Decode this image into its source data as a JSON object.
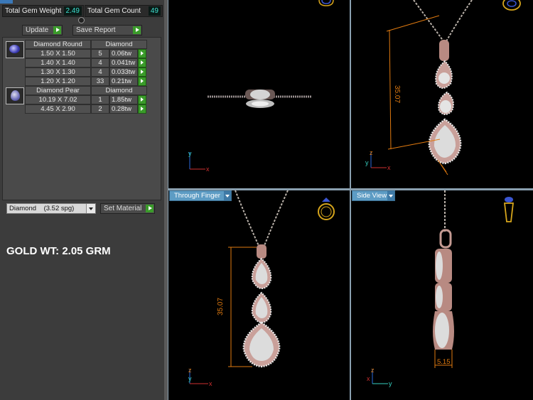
{
  "stats": {
    "total_gem_weight_label": "Total Gem Weight",
    "total_gem_weight_value": "2.49",
    "total_gem_count_label": "Total Gem Count",
    "total_gem_count_value": "49"
  },
  "toolbar": {
    "update_label": "Update",
    "save_report_label": "Save Report"
  },
  "round_table": {
    "header_size": "Diamond Round",
    "header_material": "Diamond",
    "rows": [
      {
        "size": "1.50 X 1.50",
        "count": "5",
        "weight": "0.06tw"
      },
      {
        "size": "1.40 X 1.40",
        "count": "4",
        "weight": "0.041tw"
      },
      {
        "size": "1.30 X 1.30",
        "count": "4",
        "weight": "0.033tw"
      },
      {
        "size": "1.20 X 1.20",
        "count": "33",
        "weight": "0.21tw"
      }
    ]
  },
  "pear_table": {
    "header_size": "Diamond Pear",
    "header_material": "Diamond",
    "rows": [
      {
        "size": "10.19 X 7.02",
        "count": "1",
        "weight": "1.85tw"
      },
      {
        "size": "4.45 X 2.90",
        "count": "2",
        "weight": "0.28tw"
      }
    ]
  },
  "material": {
    "selected": "Diamond    (3.52 spg)",
    "set_label": "Set Material"
  },
  "gold_weight": "GOLD WT: 2.05 GRM",
  "viewports": {
    "front_dimension": "35.07",
    "finger_dimension": "35.07",
    "side_dimension": "5.15",
    "through_finger_label": "Through Finger",
    "side_view_label": "Side View"
  },
  "axis": {
    "x": "x",
    "y": "y",
    "z": "z"
  },
  "colors": {
    "dimension": "#e07a10",
    "metal": "#c89a92",
    "tab": "#5d9cc4",
    "accent_green": "#3a9b2a"
  }
}
